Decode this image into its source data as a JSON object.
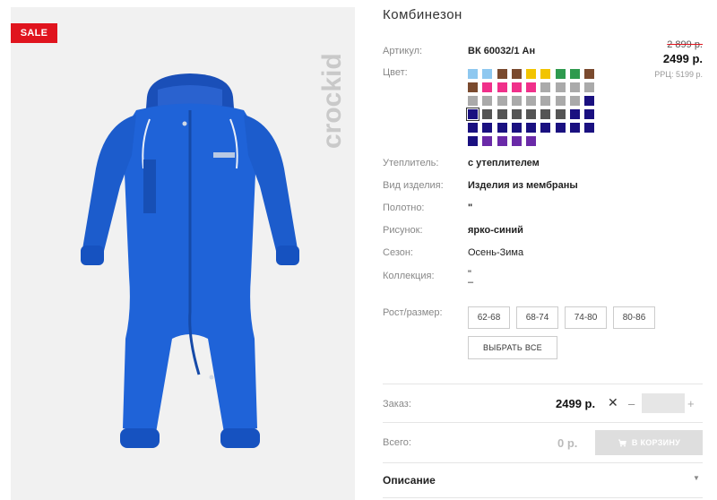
{
  "badge": {
    "sale": "SALE"
  },
  "brand": {
    "logo_text": "crockid"
  },
  "product": {
    "title": "Комбинезон",
    "article_label": "Артикул:",
    "article_value": "ВК 60032/1 Ан",
    "color_label": "Цвет:",
    "insulation_label": "Утеплитель:",
    "insulation_value": "с утеплителем",
    "type_label": "Вид изделия:",
    "type_value": "Изделия из мембраны",
    "fabric_label": "Полотно:",
    "fabric_value": "\"",
    "pattern_label": "Рисунок:",
    "pattern_value": "ярко-синий",
    "season_label": "Сезон:",
    "season_value": "Осень-Зима",
    "collection_label": "Коллекция:",
    "collection_value_1": "\"",
    "collection_value_2": "–",
    "size_label": "Рост/размер:"
  },
  "price": {
    "old": "2 899 р.",
    "current": "2499 р.",
    "rrc": "РРЦ: 5199 р."
  },
  "swatches": [
    "#8ec8f0",
    "#8ec8f0",
    "#7a4a2e",
    "#7a4a2e",
    "#f2c400",
    "#f2c400",
    "#2e9a4e",
    "#2e9a4e",
    "#7a4a2e",
    "#7a4a2e",
    "#f0308a",
    "#f0308a",
    "#f0308a",
    "#f0308a",
    "#aaaaaa",
    "#aaaaaa",
    "#aaaaaa",
    "#aaaaaa",
    "#aaaaaa",
    "#aaaaaa",
    "#aaaaaa",
    "#aaaaaa",
    "#aaaaaa",
    "#aaaaaa",
    "#aaaaaa",
    "#aaaaaa",
    "#1a1080",
    "#1a1080",
    "#555555",
    "#555555",
    "#555555",
    "#555555",
    "#555555",
    "#555555",
    "#1a1080",
    "#1a1080",
    "#1a1080",
    "#1a1080",
    "#1a1080",
    "#1a1080",
    "#1a1080",
    "#1a1080",
    "#1a1080",
    "#1a1080",
    "#1a1080",
    "#1a1080",
    "#6a2aa8",
    "#6a2aa8",
    "#6a2aa8",
    "#6a2aa8"
  ],
  "selected_swatch": 27,
  "sizes": [
    "62-68",
    "68-74",
    "74-80",
    "80-86"
  ],
  "select_all": "ВЫБРАТЬ ВСЕ",
  "order": {
    "label": "Заказ:",
    "price": "2499 р.",
    "times": "✕",
    "minus": "–",
    "quantity": "",
    "plus": "+"
  },
  "total": {
    "label": "Всего:",
    "value": "0 р.",
    "cart_button": "В КОРЗИНУ"
  },
  "description": {
    "label": "Описание",
    "chevron": "▼"
  },
  "colors": {
    "sale_red": "#e0141e",
    "product_blue": "#1f63d8"
  }
}
